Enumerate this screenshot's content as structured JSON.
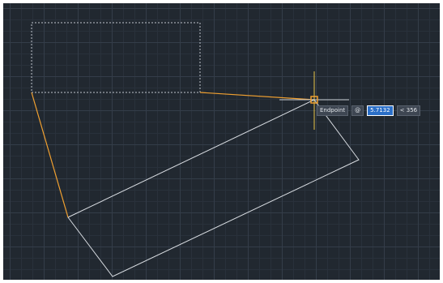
{
  "dynamic_input": {
    "snap_label": "Endpoint",
    "at_symbol": "@",
    "length_value": "5.7132",
    "angle_value": "< 356"
  },
  "colors": {
    "canvas": "#212830",
    "grid_minor": "#29313b",
    "grid_major": "#343d49",
    "entity": "#d9dde2",
    "rubber_band": "#f0a030",
    "crosshair": "#e8c547",
    "snap_marker": "#f0a030",
    "input_field": "#2b6fc8"
  },
  "icons": {
    "cursor": "crosshair-cursor-icon",
    "snap": "endpoint-snap-marker-icon"
  }
}
